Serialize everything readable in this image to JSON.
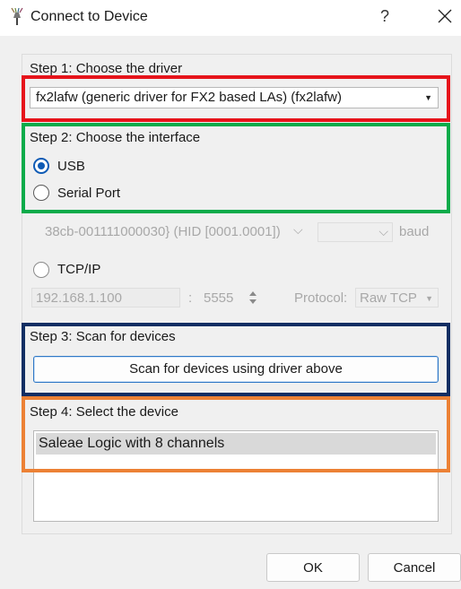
{
  "window": {
    "title": "Connect to Device",
    "help_label": "?",
    "app_icon": "pulseview-probe-icon",
    "close_icon": "close-icon"
  },
  "step1": {
    "label": "Step 1: Choose the driver",
    "driver_value": "fx2lafw (generic driver for FX2 based LAs) (fx2lafw)"
  },
  "step2": {
    "label": "Step 2: Choose the interface",
    "options": [
      {
        "label": "USB",
        "checked": true
      },
      {
        "label": "Serial Port",
        "checked": false
      }
    ],
    "serial_port_value": "38cb-001111000030} (HID [0001.0001])",
    "baud_value": "",
    "baud_label": "baud",
    "tcp_label": "TCP/IP",
    "ip_value": "192.168.1.100",
    "colon": ":",
    "port_value": "5555",
    "protocol_label": "Protocol:",
    "protocol_value": "Raw TCP"
  },
  "step3": {
    "label": "Step 3: Scan for devices",
    "scan_button_label": "Scan for devices using driver above"
  },
  "step4": {
    "label": "Step 4: Select the device",
    "devices": [
      "Saleae Logic with 8 channels"
    ]
  },
  "footer": {
    "ok_label": "OK",
    "cancel_label": "Cancel"
  },
  "highlight_colors": {
    "step1": "#e6141b",
    "step2": "#0aab4a",
    "step3": "#112e63",
    "step4": "#ec8135"
  },
  "accent_color": "#0f5bb5"
}
